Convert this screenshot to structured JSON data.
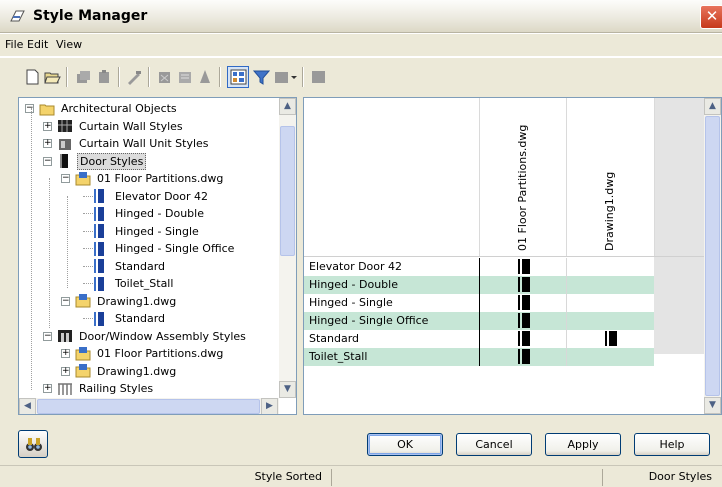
{
  "window": {
    "title": "Style Manager",
    "close_glyph": "✕"
  },
  "menu": [
    "File",
    "Edit",
    "View"
  ],
  "toolbar": {
    "icons": [
      "new-icon",
      "open-icon",
      "copy-icon",
      "paste-icon",
      "edit-style-icon",
      "purge-icon",
      "set-from-icon",
      "import-icon",
      "toggle-view-icon",
      "filter-icon",
      "inline-edit-icon",
      "dropdown-icon",
      "display-icon"
    ]
  },
  "tree": {
    "rows": [
      {
        "label": "Architectural Objects",
        "level": 0,
        "icon": "folder-icon",
        "expander": "−"
      },
      {
        "label": "Curtain Wall Styles",
        "level": 1,
        "icon": "curtain-wall-icon",
        "expander": "+"
      },
      {
        "label": "Curtain Wall Unit Styles",
        "level": 1,
        "icon": "curtain-wall-unit-icon",
        "expander": "+"
      },
      {
        "label": "Door Styles",
        "level": 1,
        "icon": "door-styles-icon",
        "expander": "−",
        "selected": true
      },
      {
        "label": "01 Floor Partitions.dwg",
        "level": 2,
        "icon": "drawing-icon",
        "expander": "−"
      },
      {
        "label": "Elevator Door 42",
        "level": 3,
        "icon": "door-icon"
      },
      {
        "label": "Hinged - Double",
        "level": 3,
        "icon": "door-icon"
      },
      {
        "label": "Hinged - Single",
        "level": 3,
        "icon": "door-icon"
      },
      {
        "label": "Hinged - Single Office",
        "level": 3,
        "icon": "door-icon"
      },
      {
        "label": "Standard",
        "level": 3,
        "icon": "door-icon"
      },
      {
        "label": "Toilet_Stall",
        "level": 3,
        "icon": "door-icon"
      },
      {
        "label": "Drawing1.dwg",
        "level": 2,
        "icon": "drawing-icon",
        "expander": "−"
      },
      {
        "label": "Standard",
        "level": 3,
        "icon": "door-icon"
      },
      {
        "label": "Door/Window Assembly Styles",
        "level": 1,
        "icon": "door-window-assembly-icon",
        "expander": "−"
      },
      {
        "label": "01 Floor Partitions.dwg",
        "level": 2,
        "icon": "drawing-icon",
        "expander": "+"
      },
      {
        "label": "Drawing1.dwg",
        "level": 2,
        "icon": "drawing-icon",
        "expander": "+"
      },
      {
        "label": "Railing Styles",
        "level": 1,
        "icon": "railing-icon",
        "expander": "+"
      }
    ]
  },
  "grid": {
    "columns": [
      "01 Floor Partitions.dwg",
      "Drawing1.dwg"
    ],
    "rows": [
      {
        "name": "Elevator Door 42",
        "in_col1": true,
        "in_col2": false,
        "highlight": false
      },
      {
        "name": "Hinged - Double",
        "in_col1": true,
        "in_col2": false,
        "highlight": true
      },
      {
        "name": "Hinged - Single",
        "in_col1": true,
        "in_col2": false,
        "highlight": false
      },
      {
        "name": "Hinged - Single Office",
        "in_col1": true,
        "in_col2": false,
        "highlight": true
      },
      {
        "name": "Standard",
        "in_col1": true,
        "in_col2": true,
        "highlight": false
      },
      {
        "name": "Toilet_Stall",
        "in_col1": true,
        "in_col2": false,
        "highlight": true
      }
    ],
    "highlight_color": "#c6e6d6"
  },
  "buttons": {
    "ok": "OK",
    "cancel": "Cancel",
    "apply": "Apply",
    "help": "Help"
  },
  "status": {
    "message": "Style Sorted",
    "section": "Door Styles"
  }
}
